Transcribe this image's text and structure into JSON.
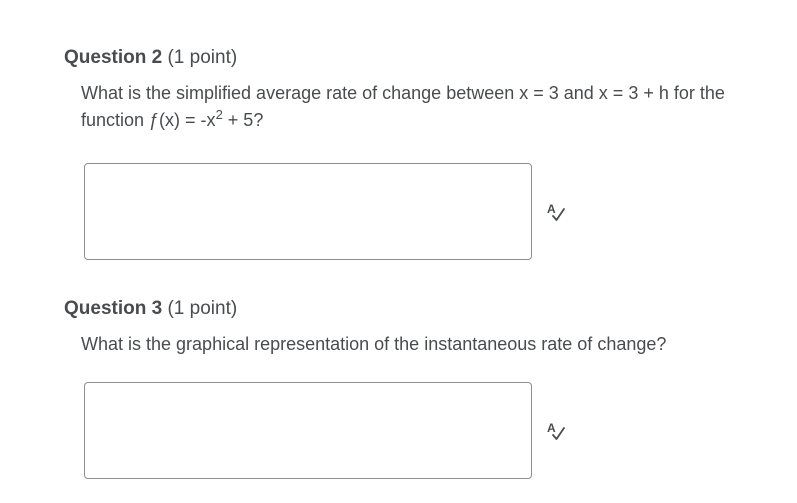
{
  "questions": [
    {
      "title": "Question 2",
      "points": "(1 point)",
      "prompt_before": "What is the simplified average rate of change between x = 3 and x = 3 + h for the function ƒ(x) = -x",
      "prompt_sup": "2",
      "prompt_after": " + 5?",
      "answer_value": "",
      "spellcheck_icon": "spellcheck-icon"
    },
    {
      "title": "Question 3",
      "points": "(1 point)",
      "prompt": "What is the graphical representation of the instantaneous rate of change?",
      "answer_value": "",
      "spellcheck_icon": "spellcheck-icon"
    }
  ]
}
